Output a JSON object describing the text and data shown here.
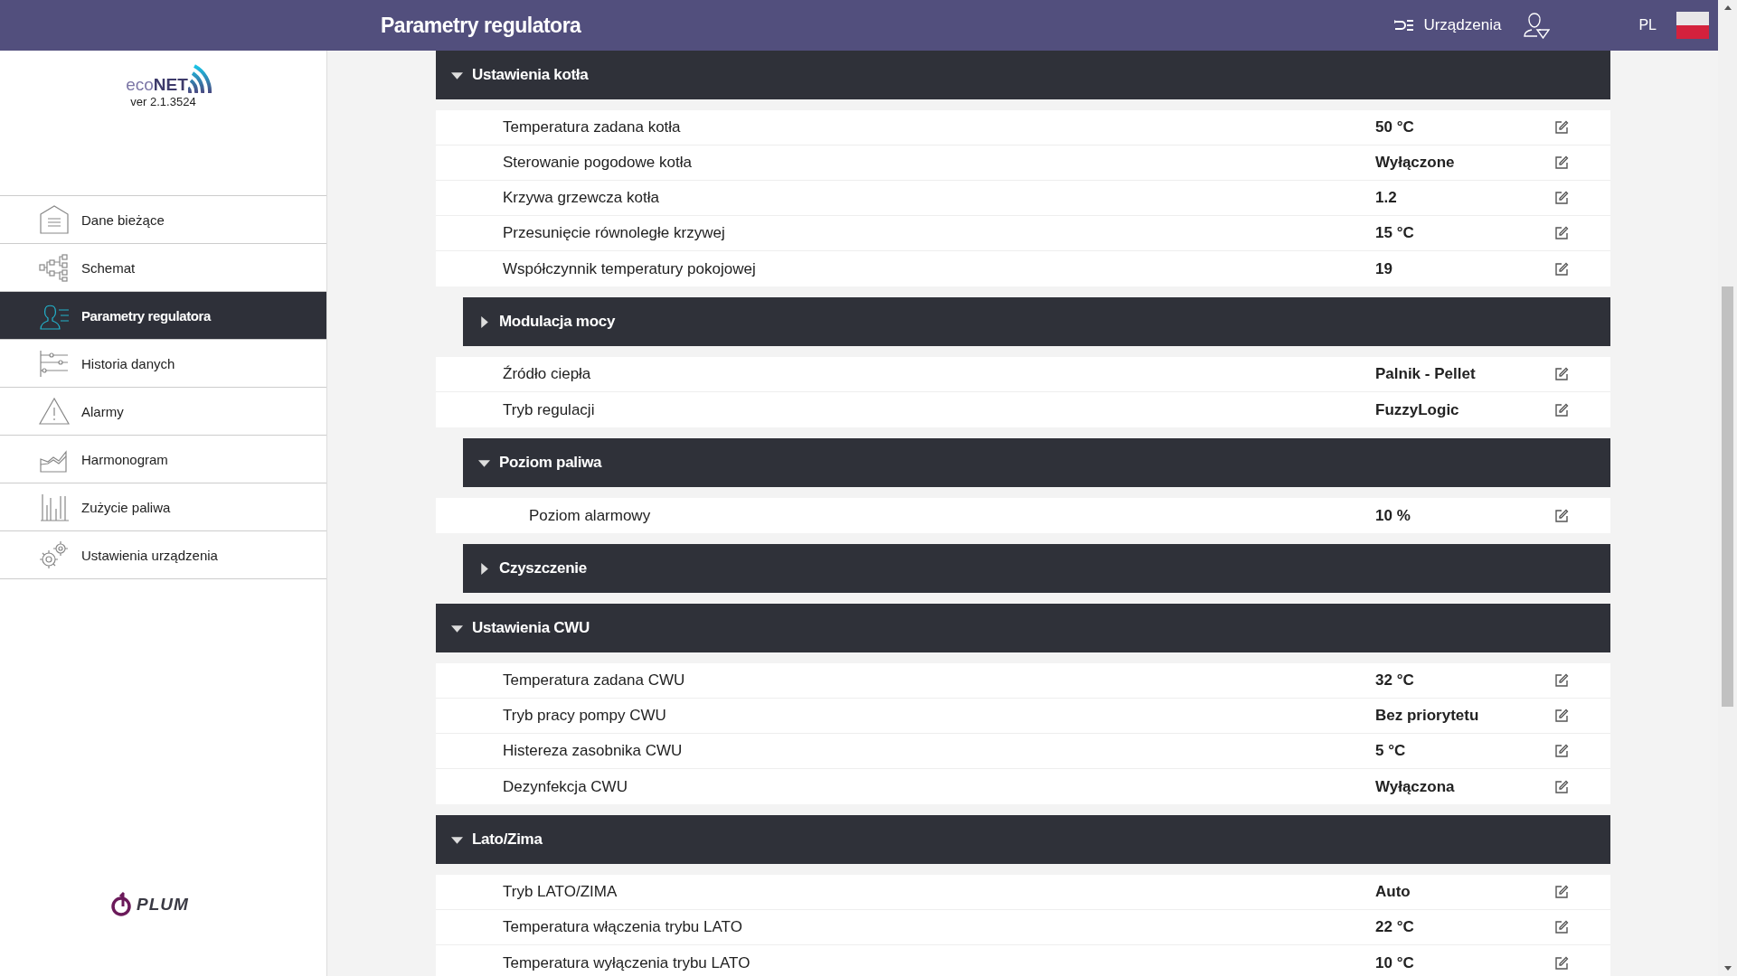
{
  "header": {
    "title": "Parametry regulatora",
    "devices_label": "Urządzenia",
    "language": "PL"
  },
  "sidebar": {
    "logo": "eco**NET**",
    "version": "ver 2.1.3524",
    "footer_logo": "PLUM",
    "items": [
      {
        "label": "Dane bieżące",
        "selected": false
      },
      {
        "label": "Schemat",
        "selected": false
      },
      {
        "label": "Parametry regulatora",
        "selected": true
      },
      {
        "label": "Historia danych",
        "selected": false
      },
      {
        "label": "Alarmy",
        "selected": false
      },
      {
        "label": "Harmonogram",
        "selected": false
      },
      {
        "label": "Zużycie paliwa",
        "selected": false
      },
      {
        "label": "Ustawienia urządzenia",
        "selected": false
      }
    ]
  },
  "sections": [
    {
      "kind": "group",
      "title": "Ustawienia kotła",
      "expanded": true,
      "children": [
        {
          "kind": "param",
          "label": "Temperatura zadana kotła",
          "value": "50 °C"
        },
        {
          "kind": "param",
          "label": "Sterowanie pogodowe kotła",
          "value": "Wyłączone"
        },
        {
          "kind": "param",
          "label": "Krzywa grzewcza kotła",
          "value": "1.2"
        },
        {
          "kind": "param",
          "label": "Przesunięcie równoległe krzywej",
          "value": "15 °C"
        },
        {
          "kind": "param",
          "label": "Współczynnik temperatury pokojowej",
          "value": "19"
        },
        {
          "kind": "group",
          "title": "Modulacja mocy",
          "expanded": false
        },
        {
          "kind": "param",
          "label": "Źródło ciepła",
          "value": "Palnik - Pellet"
        },
        {
          "kind": "param",
          "label": "Tryb regulacji",
          "value": "FuzzyLogic"
        },
        {
          "kind": "group",
          "title": "Poziom paliwa",
          "expanded": true,
          "children": [
            {
              "kind": "param",
              "label": "Poziom alarmowy",
              "value": "10 %"
            }
          ]
        },
        {
          "kind": "group",
          "title": "Czyszczenie",
          "expanded": false
        }
      ]
    },
    {
      "kind": "group",
      "title": "Ustawienia CWU",
      "expanded": true,
      "children": [
        {
          "kind": "param",
          "label": "Temperatura zadana CWU",
          "value": "32 °C"
        },
        {
          "kind": "param",
          "label": "Tryb pracy pompy CWU",
          "value": "Bez priorytetu"
        },
        {
          "kind": "param",
          "label": "Histereza zasobnika CWU",
          "value": "5 °C"
        },
        {
          "kind": "param",
          "label": "Dezynfekcja CWU",
          "value": "Wyłączona"
        }
      ]
    },
    {
      "kind": "group",
      "title": "Lato/Zima",
      "expanded": true,
      "children": [
        {
          "kind": "param",
          "label": "Tryb LATO/ZIMA",
          "value": "Auto"
        },
        {
          "kind": "param",
          "label": "Temperatura włączenia trybu LATO",
          "value": "22 °C"
        },
        {
          "kind": "param",
          "label": "Temperatura wyłączenia trybu LATO",
          "value": "10 °C"
        }
      ]
    }
  ]
}
